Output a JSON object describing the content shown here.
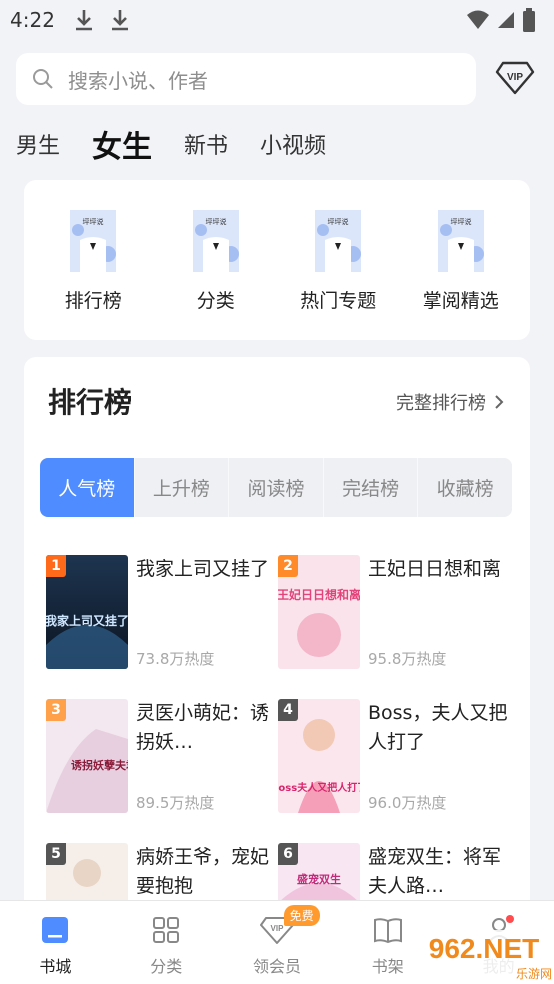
{
  "status_bar": {
    "time": "4:22"
  },
  "search": {
    "placeholder": "搜索小说、作者"
  },
  "channels": [
    {
      "label": "男生",
      "active": false
    },
    {
      "label": "女生",
      "active": true
    },
    {
      "label": "新书",
      "active": false
    },
    {
      "label": "小视频",
      "active": false
    }
  ],
  "entries": [
    {
      "label": "排行榜",
      "thumb_text": "坪坪说"
    },
    {
      "label": "分类",
      "thumb_text": "坪坪说"
    },
    {
      "label": "热门专题",
      "thumb_text": "坪坪说"
    },
    {
      "label": "掌阅精选",
      "thumb_text": "坪坪说"
    }
  ],
  "ranking": {
    "title": "排行榜",
    "more_label": "完整排行榜",
    "tabs": [
      "人气榜",
      "上升榜",
      "阅读榜",
      "完结榜",
      "收藏榜"
    ],
    "active_tab": 0,
    "books": [
      {
        "rank": "1",
        "title": "我家上司又挂了",
        "heat": "73.8万热度",
        "badge_color": "#ff6a1a",
        "cover_text": "我家上司又挂了"
      },
      {
        "rank": "2",
        "title": "王妃日日想和离",
        "heat": "95.8万热度",
        "badge_color": "#ff8a2a",
        "cover_text": "王妃日日想和离"
      },
      {
        "rank": "3",
        "title": "灵医小萌妃：诱拐妖…",
        "heat": "89.5万热度",
        "badge_color": "#ffa04a",
        "cover_text": "诱拐妖孽夫君"
      },
      {
        "rank": "4",
        "title": "Boss，夫人又把人打了",
        "heat": "96.0万热度",
        "badge_color": "#555555",
        "cover_text": "Boss夫人又把人打了"
      },
      {
        "rank": "5",
        "title": "病娇王爷，宠妃要抱抱",
        "heat": "",
        "badge_color": "#555555",
        "cover_text": ""
      },
      {
        "rank": "6",
        "title": "盛宠双生：将军夫人路…",
        "heat": "",
        "badge_color": "#555555",
        "cover_text": "盛宠双生"
      }
    ]
  },
  "bottom_nav": [
    {
      "label": "书城",
      "icon": "bookstore-icon",
      "active": true
    },
    {
      "label": "分类",
      "icon": "category-grid-icon",
      "active": false
    },
    {
      "label": "领会员",
      "icon": "vip-diamond-icon",
      "active": false,
      "badge": "免费"
    },
    {
      "label": "书架",
      "icon": "bookshelf-icon",
      "active": false
    },
    {
      "label": "我的",
      "icon": "profile-icon",
      "active": false
    }
  ],
  "watermark": {
    "text": "962.NET",
    "subtext": "乐游网"
  },
  "colors": {
    "accent": "#4e8cff",
    "badge_orange": "#ff6a1a",
    "free_badge": "#ff9a2e"
  }
}
